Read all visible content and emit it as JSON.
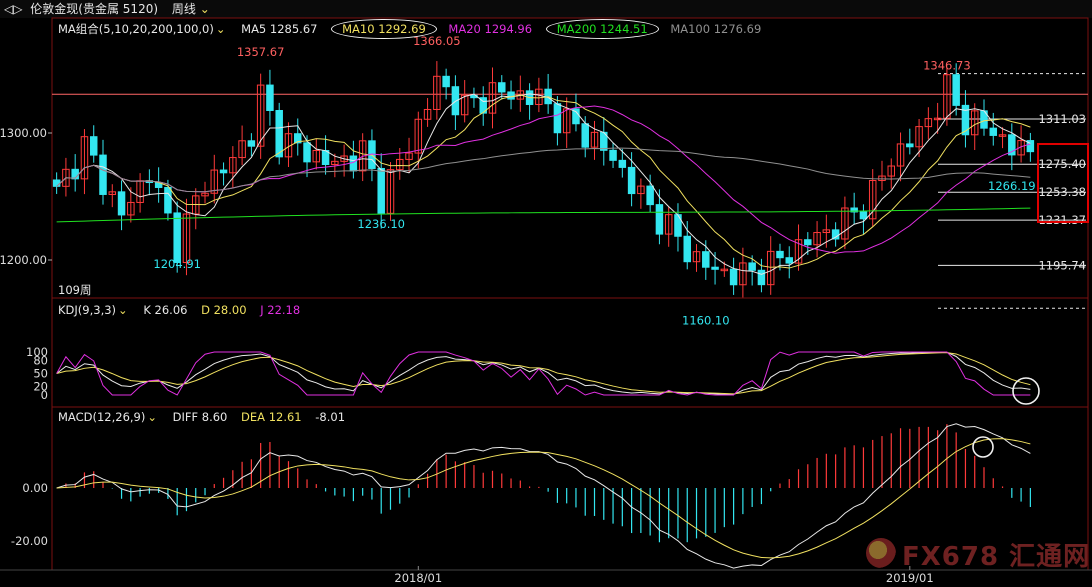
{
  "window": {
    "title": "伦敦金现(贵金属 5120)",
    "period": "周线",
    "icons": [
      "back-forward-arrows-icon",
      "chevron-down-icon"
    ]
  },
  "ma_legend": {
    "label": "MA组合(5,10,20,200,100,0)",
    "items": [
      {
        "text": "MA5 1285.67",
        "color": "#e8e8e8",
        "circled": false
      },
      {
        "text": "MA10 1292.69",
        "color": "#f0e060",
        "circled": true
      },
      {
        "text": "MA20 1294.96",
        "color": "#e030e0",
        "circled": false
      },
      {
        "text": "MA200 1244.51",
        "color": "#20e020",
        "circled": true
      },
      {
        "text": "MA100 1276.69",
        "color": "#909090",
        "circled": false
      }
    ]
  },
  "kdj_legend": {
    "label": "KDJ(9,3,3)",
    "items": [
      {
        "text": "K 26.06",
        "color": "#e8e8e8"
      },
      {
        "text": "D 28.00",
        "color": "#f0e060"
      },
      {
        "text": "J 22.18",
        "color": "#e030e0"
      }
    ]
  },
  "macd_legend": {
    "label": "MACD(12,26,9)",
    "items": [
      {
        "text": "DIFF 8.60",
        "color": "#e8e8e8"
      },
      {
        "text": "DEA 12.61",
        "color": "#f0e060"
      },
      {
        "text": "-8.01",
        "color": "#e8e8e8"
      }
    ]
  },
  "labels": {
    "bars": "109周",
    "watermark": "FX678 汇通网"
  },
  "colors": {
    "up": "#ff3a3a",
    "down": "#33e6f0",
    "ma5": "#e8e8e8",
    "ma10": "#f0e060",
    "ma20": "#e030e0",
    "ma100": "#909090",
    "ma200": "#20e020",
    "resistance": "#ff6666",
    "grid": "#7a1010"
  },
  "chart_data": {
    "type": "candlestick",
    "title": "伦敦金现 周线",
    "price_axis": {
      "ticks": [
        1200.0,
        1300.0
      ],
      "range": [
        1162,
        1340
      ]
    },
    "kdj_axis": {
      "ticks": [
        100,
        80,
        50,
        20,
        0
      ]
    },
    "macd_axis": {
      "ticks": [
        0.0,
        -20.0
      ]
    },
    "date_ticks": [
      {
        "label": "2018/01",
        "index": 39
      },
      {
        "label": "2019/01",
        "index": 92
      }
    ],
    "annotations": [
      {
        "text": "1357.67",
        "index": 22,
        "price": 1357.67,
        "color": "#ff6060",
        "pos": "above"
      },
      {
        "text": "1366.05",
        "index": 41,
        "price": 1366.05,
        "color": "#ff6060",
        "pos": "above"
      },
      {
        "text": "1236.10",
        "index": 35,
        "price": 1236.1,
        "color": "#33e6f0",
        "pos": "below"
      },
      {
        "text": "1204.91",
        "index": 13,
        "price": 1204.91,
        "color": "#33e6f0",
        "pos": "below"
      },
      {
        "text": "1160.10",
        "index": 70,
        "price": 1160.1,
        "color": "#33e6f0",
        "pos": "below"
      },
      {
        "text": "1346.73",
        "index": 96,
        "price": 1346.73,
        "color": "#ff6060",
        "pos": "above"
      },
      {
        "text": "1266.19",
        "index": 103,
        "price": 1266.19,
        "color": "#33e6f0",
        "pos": "below"
      }
    ],
    "levels": [
      {
        "value": 1346.73,
        "label": "",
        "style": "dash"
      },
      {
        "value": 1311.03,
        "label": "1311.03",
        "style": "solid"
      },
      {
        "value": 1275.4,
        "label": "1275.40",
        "style": "solid"
      },
      {
        "value": 1253.38,
        "label": "1253.38",
        "style": "solid"
      },
      {
        "value": 1231.37,
        "label": "1231.37",
        "style": "solid"
      },
      {
        "value": 1195.74,
        "label": "1195.74",
        "style": "solid"
      },
      {
        "value": 1162.0,
        "label": "",
        "style": "dash"
      }
    ],
    "resistance_line": 1330.5
  }
}
